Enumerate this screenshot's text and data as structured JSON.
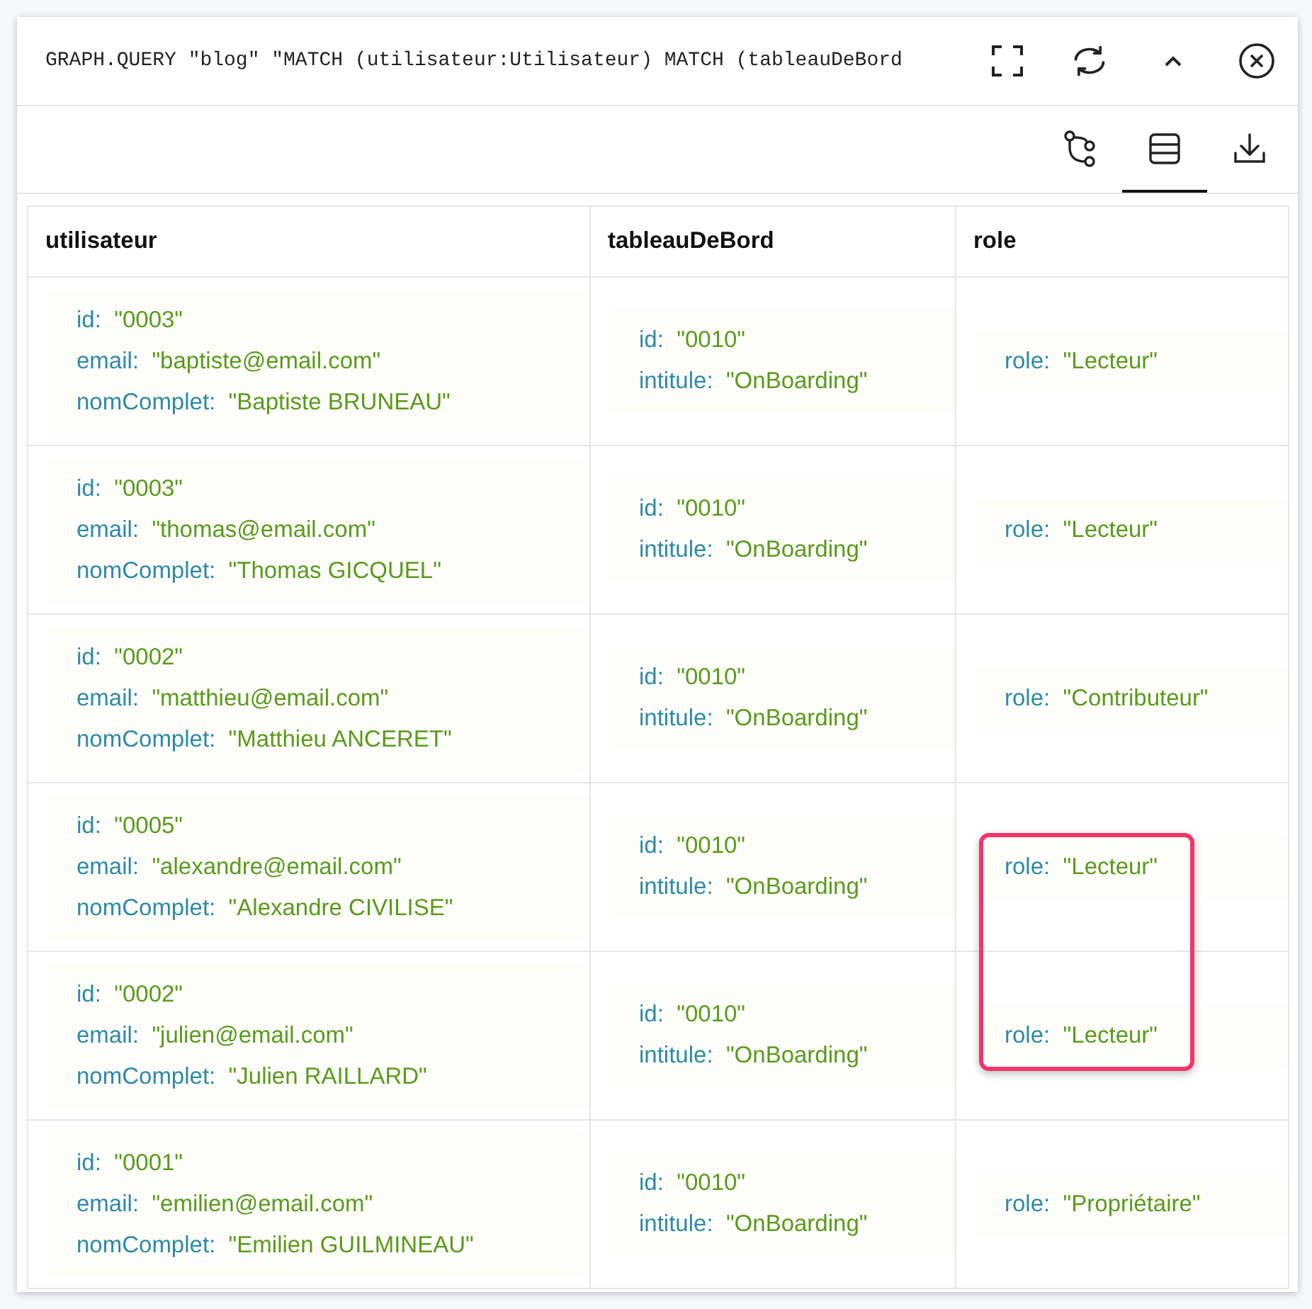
{
  "query": "GRAPH.QUERY \"blog\" \"MATCH (utilisateur:Utilisateur) MATCH (tableauDeBord",
  "views": [
    {
      "kind": "graph",
      "selected": false
    },
    {
      "kind": "table",
      "selected": true
    }
  ],
  "table": {
    "columns": [
      "utilisateur",
      "tableauDeBord",
      "role"
    ],
    "rows": [
      {
        "cells": [
          {
            "fields": [
              {
                "key": "id:",
                "value": "\"0003\""
              },
              {
                "key": "email:",
                "value": "\"baptiste@email.com\""
              },
              {
                "key": "nomComplet:",
                "value": "\"Baptiste BRUNEAU\""
              }
            ]
          },
          {
            "fields": [
              {
                "key": "id:",
                "value": "\"0010\""
              },
              {
                "key": "intitule:",
                "value": "\"OnBoarding\""
              }
            ]
          },
          {
            "highlighted": false,
            "fields": [
              {
                "key": "role:",
                "value": "\"Lecteur\""
              }
            ]
          }
        ]
      },
      {
        "cells": [
          {
            "fields": [
              {
                "key": "id:",
                "value": "\"0003\""
              },
              {
                "key": "email:",
                "value": "\"thomas@email.com\""
              },
              {
                "key": "nomComplet:",
                "value": "\"Thomas GICQUEL\""
              }
            ]
          },
          {
            "fields": [
              {
                "key": "id:",
                "value": "\"0010\""
              },
              {
                "key": "intitule:",
                "value": "\"OnBoarding\""
              }
            ]
          },
          {
            "highlighted": false,
            "fields": [
              {
                "key": "role:",
                "value": "\"Lecteur\""
              }
            ]
          }
        ]
      },
      {
        "cells": [
          {
            "fields": [
              {
                "key": "id:",
                "value": "\"0002\""
              },
              {
                "key": "email:",
                "value": "\"matthieu@email.com\""
              },
              {
                "key": "nomComplet:",
                "value": "\"Matthieu ANCERET\""
              }
            ]
          },
          {
            "fields": [
              {
                "key": "id:",
                "value": "\"0010\""
              },
              {
                "key": "intitule:",
                "value": "\"OnBoarding\""
              }
            ]
          },
          {
            "highlighted": false,
            "fields": [
              {
                "key": "role:",
                "value": "\"Contributeur\""
              }
            ]
          }
        ]
      },
      {
        "cells": [
          {
            "fields": [
              {
                "key": "id:",
                "value": "\"0005\""
              },
              {
                "key": "email:",
                "value": "\"alexandre@email.com\""
              },
              {
                "key": "nomComplet:",
                "value": "\"Alexandre CIVILISE\""
              }
            ]
          },
          {
            "fields": [
              {
                "key": "id:",
                "value": "\"0010\""
              },
              {
                "key": "intitule:",
                "value": "\"OnBoarding\""
              }
            ]
          },
          {
            "highlighted": true,
            "fields": [
              {
                "key": "role:",
                "value": "\"Lecteur\""
              }
            ]
          }
        ]
      },
      {
        "cells": [
          {
            "fields": [
              {
                "key": "id:",
                "value": "\"0002\""
              },
              {
                "key": "email:",
                "value": "\"julien@email.com\""
              },
              {
                "key": "nomComplet:",
                "value": "\"Julien RAILLARD\""
              }
            ]
          },
          {
            "fields": [
              {
                "key": "id:",
                "value": "\"0010\""
              },
              {
                "key": "intitule:",
                "value": "\"OnBoarding\""
              }
            ]
          },
          {
            "highlighted": true,
            "fields": [
              {
                "key": "role:",
                "value": "\"Lecteur\""
              }
            ]
          }
        ]
      },
      {
        "cells": [
          {
            "fields": [
              {
                "key": "id:",
                "value": "\"0001\""
              },
              {
                "key": "email:",
                "value": "\"emilien@email.com\""
              },
              {
                "key": "nomComplet:",
                "value": "\"Emilien GUILMINEAU\""
              }
            ]
          },
          {
            "fields": [
              {
                "key": "id:",
                "value": "\"0010\""
              },
              {
                "key": "intitule:",
                "value": "\"OnBoarding\""
              }
            ]
          },
          {
            "highlighted": false,
            "fields": [
              {
                "key": "role:",
                "value": "\"Propriétaire\""
              }
            ]
          }
        ]
      }
    ]
  }
}
